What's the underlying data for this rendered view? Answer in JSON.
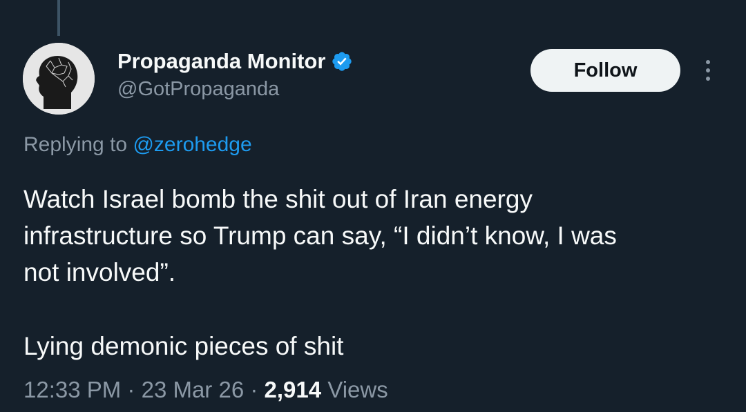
{
  "author": {
    "display_name": "Propaganda Monitor",
    "handle": "@GotPropaganda",
    "verified": true,
    "avatar_icon": "head-silhouette-icon"
  },
  "actions": {
    "follow_label": "Follow",
    "more_icon": "more-vertical-icon"
  },
  "reply_context": {
    "prefix": "Replying to",
    "mention": "@zerohedge"
  },
  "tweet": {
    "lines": [
      "Watch Israel bomb the shit out of Iran energy",
      "infrastructure so Trump can say, “I didn’t know, I was",
      "not involved”.",
      "Lying demonic pieces of shit"
    ]
  },
  "meta": {
    "time": "12:33 PM",
    "separator": "·",
    "date": "23 Mar 26",
    "views_count": "2,914",
    "views_label": "Views"
  },
  "colors": {
    "background": "#15202b",
    "text_primary": "#f7f9f9",
    "text_secondary": "#8b98a5",
    "accent": "#1d9bf0",
    "follow_bg": "#eff3f4"
  }
}
